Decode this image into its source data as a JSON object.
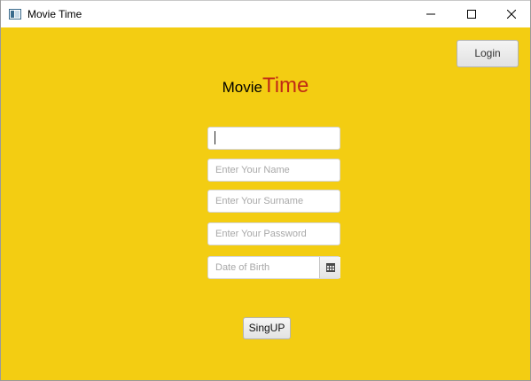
{
  "window": {
    "title": "Movie Time",
    "icon": "app-window-icon"
  },
  "header": {
    "login_label": "Login"
  },
  "brand": {
    "part1": "Movie",
    "part2": "Time",
    "accent_color": "#c02a16"
  },
  "form": {
    "first_field": {
      "value": "",
      "placeholder": ""
    },
    "name": {
      "value": "",
      "placeholder": "Enter Your Name"
    },
    "surname": {
      "value": "",
      "placeholder": "Enter Your Surname"
    },
    "password": {
      "value": "",
      "placeholder": "Enter Your Password"
    },
    "dob": {
      "value": "",
      "placeholder": "Date of Birth",
      "icon": "calendar-icon"
    },
    "signup_label": "SingUP"
  },
  "colors": {
    "background": "#f3cd12"
  }
}
